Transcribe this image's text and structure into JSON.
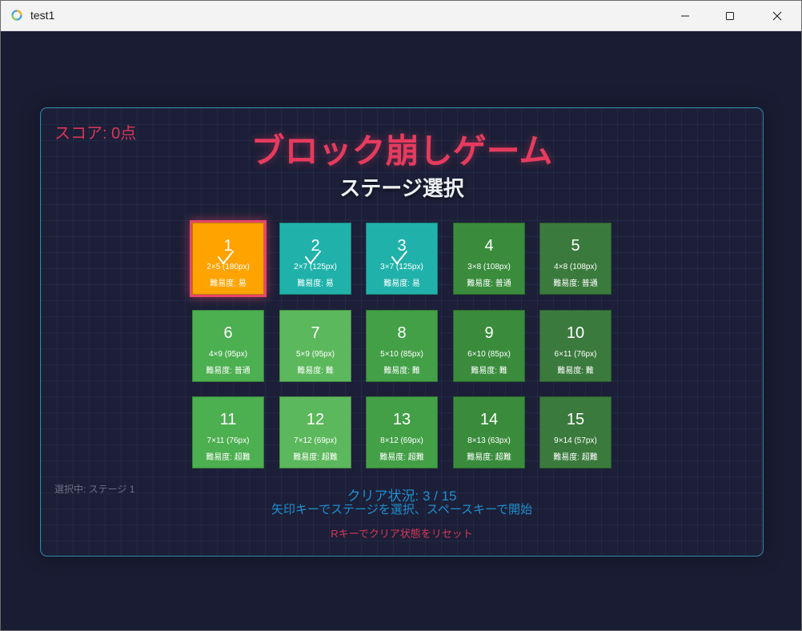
{
  "window": {
    "title": "test1",
    "app_icon": "app-ring-icon",
    "controls": [
      "minimize-icon",
      "maximize-icon",
      "close-icon"
    ]
  },
  "game": {
    "score": "スコア: 0点",
    "title": "ブロック崩しゲーム",
    "subtitle": "ステージ選択",
    "selected_label": "選択中: ステージ 1",
    "clear_status": "クリア状況: 3 / 15",
    "instructions": "矢印キーでステージを選択、スペースキーで開始",
    "reset_hint": "Rキーでクリア状態をリセット"
  },
  "stages": [
    {
      "num": "1",
      "size": "2×5 (180px)",
      "difficulty": "難易度: 易",
      "color": "#ffa300",
      "cleared": true,
      "selected": true
    },
    {
      "num": "2",
      "size": "2×7 (125px)",
      "difficulty": "難易度: 易",
      "color": "#20b2aa",
      "cleared": true,
      "selected": false
    },
    {
      "num": "3",
      "size": "3×7 (125px)",
      "difficulty": "難易度: 易",
      "color": "#20b2aa",
      "cleared": true,
      "selected": false
    },
    {
      "num": "4",
      "size": "3×8 (108px)",
      "difficulty": "難易度: 普通",
      "color": "#3a8c3c",
      "cleared": false,
      "selected": false
    },
    {
      "num": "5",
      "size": "4×8 (108px)",
      "difficulty": "難易度: 普通",
      "color": "#3b7a3d",
      "cleared": false,
      "selected": false
    },
    {
      "num": "6",
      "size": "4×9 (95px)",
      "difficulty": "難易度: 普通",
      "color": "#4caf50",
      "cleared": false,
      "selected": false
    },
    {
      "num": "7",
      "size": "5×9 (95px)",
      "difficulty": "難易度: 難",
      "color": "#5cb85c",
      "cleared": false,
      "selected": false
    },
    {
      "num": "8",
      "size": "5×10 (85px)",
      "difficulty": "難易度: 難",
      "color": "#43a047",
      "cleared": false,
      "selected": false
    },
    {
      "num": "9",
      "size": "6×10 (85px)",
      "difficulty": "難易度: 難",
      "color": "#3a8c3c",
      "cleared": false,
      "selected": false
    },
    {
      "num": "10",
      "size": "6×11 (76px)",
      "difficulty": "難易度: 難",
      "color": "#3b7a3d",
      "cleared": false,
      "selected": false
    },
    {
      "num": "11",
      "size": "7×11 (76px)",
      "difficulty": "難易度: 超難",
      "color": "#4caf50",
      "cleared": false,
      "selected": false
    },
    {
      "num": "12",
      "size": "7×12 (69px)",
      "difficulty": "難易度: 超難",
      "color": "#5cb85c",
      "cleared": false,
      "selected": false
    },
    {
      "num": "13",
      "size": "8×12 (69px)",
      "difficulty": "難易度: 超難",
      "color": "#43a047",
      "cleared": false,
      "selected": false
    },
    {
      "num": "14",
      "size": "8×13 (63px)",
      "difficulty": "難易度: 超難",
      "color": "#3a8c3c",
      "cleared": false,
      "selected": false
    },
    {
      "num": "15",
      "size": "9×14 (57px)",
      "difficulty": "難易度: 超難",
      "color": "#3b7a3d",
      "cleared": false,
      "selected": false
    }
  ]
}
